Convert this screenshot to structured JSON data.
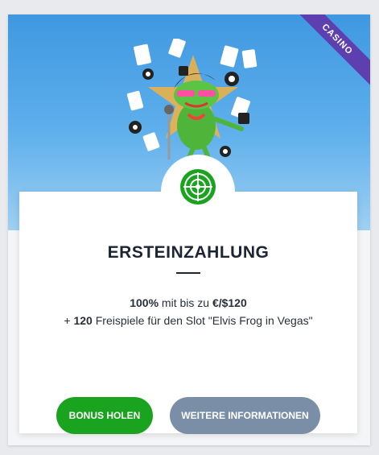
{
  "ribbon": {
    "label": "CASINO"
  },
  "offer": {
    "title": "ERSTEINZAHLUNG",
    "line1": {
      "bold_a": "100%",
      "text": " mit bis zu ",
      "bold_b": "€/$120"
    },
    "line2": {
      "prefix": "+ ",
      "bold": "120",
      "text": " Freispiele für den Slot \"Elvis Frog in Vegas\""
    }
  },
  "buttons": {
    "primary": "BONUS HOLEN",
    "secondary": "WEITERE INFORMATIONEN"
  },
  "colors": {
    "hero": "#4aa3e6",
    "ribbon": "#5d3fb0",
    "primary_button": "#1aa31e",
    "secondary_button": "#7a8ea8",
    "icon_green": "#1aa31e"
  },
  "icons": {
    "hero": "elvis-frog-illustration",
    "category": "roulette-icon"
  }
}
